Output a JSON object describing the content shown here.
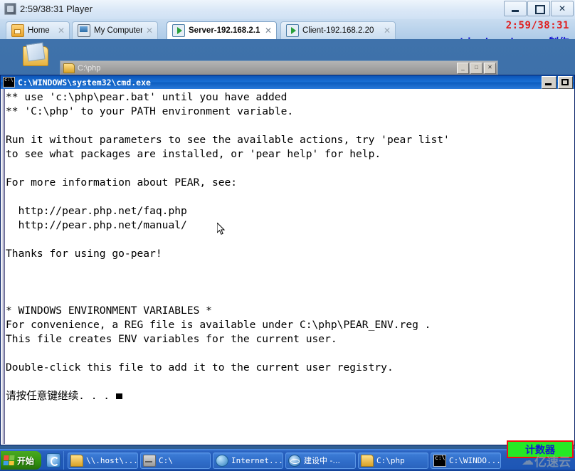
{
  "vmware": {
    "title": "2:59/38:31 Player",
    "app_icon": "vmware-player-icon",
    "window_buttons": {
      "minimize": "minimize-icon",
      "maximize": "maximize-icon",
      "close": "✕"
    },
    "tabs": [
      {
        "label": "Home",
        "icon": "home-icon",
        "close": "✕",
        "active": false
      },
      {
        "label": "My Computer",
        "icon": "monitor-icon",
        "close": "✕",
        "active": false
      },
      {
        "label": "Server-192.168.2.1",
        "icon": "vm-running-icon",
        "close": "✕",
        "active": true
      },
      {
        "label": "Client-192.168.2.20",
        "icon": "vm-running-icon",
        "close": "✕",
        "active": false
      }
    ]
  },
  "overlay": {
    "time": "2:59/38:31",
    "author": "Liuchenchang--制作",
    "time_color": "#e01d1d",
    "author_color": "#1414d2"
  },
  "desktop": {
    "icon_label": "",
    "background_window_title": "C:\\php",
    "background_window_buttons": [
      "_",
      "□",
      "✕"
    ]
  },
  "cmd": {
    "title": "C:\\WINDOWS\\system32\\cmd.exe",
    "icon": "cmd-icon",
    "buttons": {
      "minimize": "minimize-icon",
      "maximize": "maximize-icon"
    },
    "output": "** use 'c:\\php\\pear.bat' until you have added\n** 'C:\\php' to your PATH environment variable.\n\nRun it without parameters to see the available actions, try 'pear list'\nto see what packages are installed, or 'pear help' for help.\n\nFor more information about PEAR, see:\n\n  http://pear.php.net/faq.php\n  http://pear.php.net/manual/\n\nThanks for using go-pear!\n\n\n\n* WINDOWS ENVIRONMENT VARIABLES *\nFor convenience, a REG file is available under C:\\php\\PEAR_ENV.reg .\nThis file creates ENV variables for the current user.\n\nDouble-click this file to add it to the current user registry.\n\n请按任意键继续. . . ",
    "cursor": "block-cursor"
  },
  "taskbar": {
    "start_label": "开始",
    "quicklaunch_icon": "quick-launch-icon",
    "buttons": [
      {
        "label": "\\\\.host\\...",
        "icon": "folder-icon",
        "style": "mono"
      },
      {
        "label": "C:\\",
        "icon": "drive-icon",
        "style": "mono"
      },
      {
        "label": "Internet...",
        "icon": "globe-icon",
        "style": "mono"
      },
      {
        "label": "建设中 -...",
        "icon": "ie-icon",
        "style": "cn"
      },
      {
        "label": "C:\\php",
        "icon": "folder-icon",
        "style": "mono"
      },
      {
        "label": "C:\\WINDO...",
        "icon": "cmd-icon",
        "style": "mono"
      }
    ]
  },
  "highlight": {
    "text": "计数器",
    "border_color": "#ee1111",
    "fill_color": "#25e925"
  },
  "watermark": {
    "cloud_glyph": "☁",
    "text": "亿速云"
  }
}
